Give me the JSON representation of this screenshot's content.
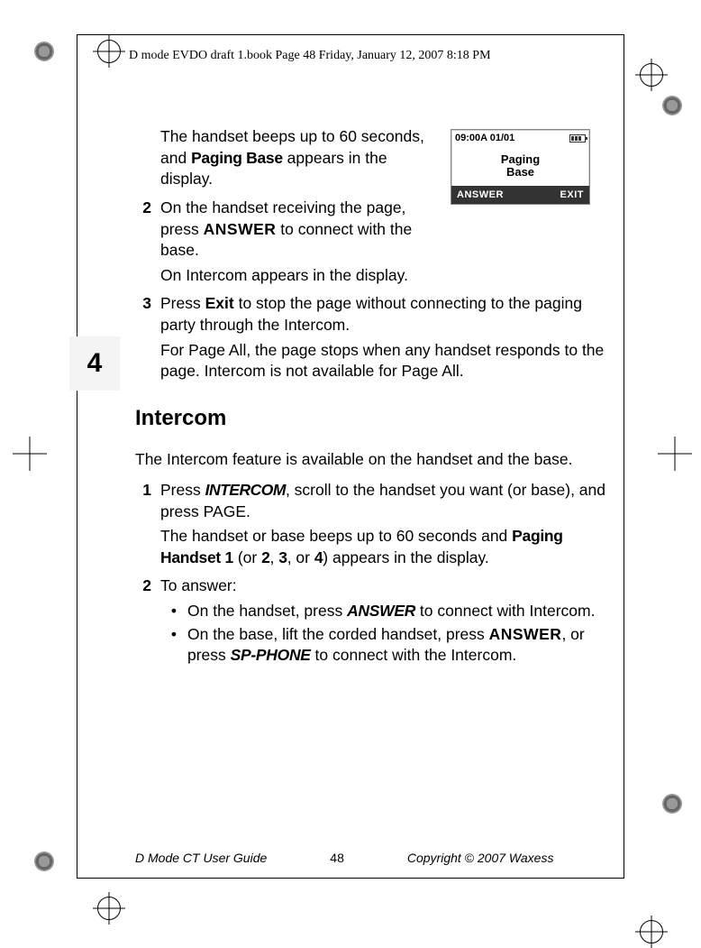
{
  "header": "D mode EVDO draft 1.book  Page 48  Friday, January 12, 2007  8:18 PM",
  "chapter_num": "4",
  "lcd": {
    "time": "09:00A 01/01",
    "line1": "Paging",
    "line2": "Base",
    "soft_left": "ANSWER",
    "soft_right": "EXIT"
  },
  "body": {
    "p1_a": "The handset beeps up to 60 seconds, and ",
    "p1_kw": "Paging Base",
    "p1_b": " appears in the display.",
    "s2_num": "2",
    "s2_a": "On the handset receiving the page, press ",
    "s2_kw": "ANSWER",
    "s2_b": " to connect with the base.",
    "s2_sub": "On Intercom appears in the display.",
    "s3_num": "3",
    "s3_a": "Press ",
    "s3_kw": "Exit",
    "s3_b": " to stop the page without connecting to the paging party through the Intercom.",
    "s3_sub": "For Page All, the page stops when any handset responds to the page. Intercom is not available for Page All.",
    "section_title": "Intercom",
    "intro": "The Intercom feature is available on the handset and the base.",
    "i1_num": "1",
    "i1_a": "Press ",
    "i1_kw": "INTERCOM",
    "i1_b": ", scroll to the handset you want (or base), and press PAGE.",
    "i1_sub_a": "The handset or base beeps up to 60 seconds and ",
    "i1_sub_kw": "Paging Handset 1",
    "i1_sub_b": " (or ",
    "i1_sub_2": "2",
    "i1_sub_c": ", ",
    "i1_sub_3": "3",
    "i1_sub_d": ", or ",
    "i1_sub_4": "4",
    "i1_sub_e": ") appears in the display.",
    "i2_num": "2",
    "i2_a": "To answer:",
    "b1_a": "On the handset, press ",
    "b1_kw": "ANSWER",
    "b1_b": " to connect with Intercom.",
    "b2_a": "On the base, lift the corded handset, press ",
    "b2_kw1": "ANSWER",
    "b2_b": ", or press ",
    "b2_kw2": "SP-PHONE",
    "b2_c": " to connect with the Intercom."
  },
  "footer": {
    "left": "D Mode CT User Guide",
    "page": "48",
    "right": "Copyright © 2007 Waxess"
  }
}
